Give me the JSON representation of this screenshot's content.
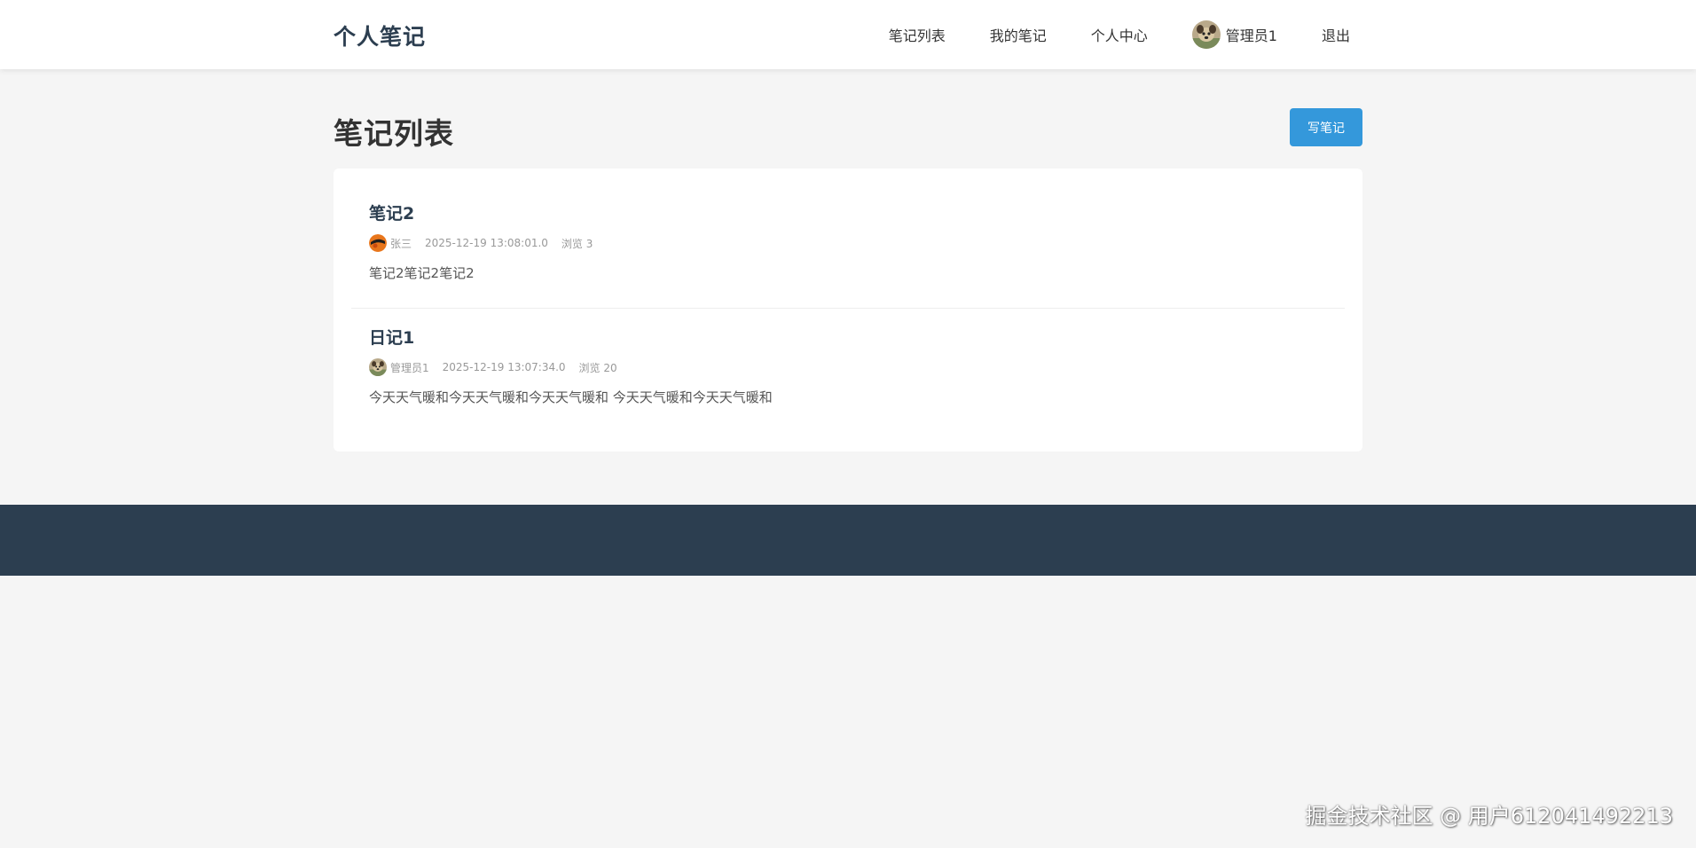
{
  "header": {
    "brand": "个人笔记",
    "nav": {
      "note_list": "笔记列表",
      "my_notes": "我的笔记",
      "profile": "个人中心",
      "user_name": "管理员1",
      "logout": "退出"
    }
  },
  "main": {
    "title": "笔记列表",
    "write_button": "写笔记",
    "notes": [
      {
        "title": "笔记2",
        "author": "张三",
        "time": "2025-12-19 13:08:01.0",
        "views": "浏览 3",
        "excerpt": "笔记2笔记2笔记2"
      },
      {
        "title": "日记1",
        "author": "管理员1",
        "time": "2025-12-19 13:07:34.0",
        "views": "浏览 20",
        "excerpt": "今天天气暖和今天天气暖和今天天气暖和 今天天气暖和今天天气暖和"
      }
    ]
  },
  "watermark": "掘金技术社区 @ 用户612041492213",
  "colors": {
    "primary": "#3498db",
    "dark": "#2c3e50",
    "background": "#f5f5f5"
  }
}
